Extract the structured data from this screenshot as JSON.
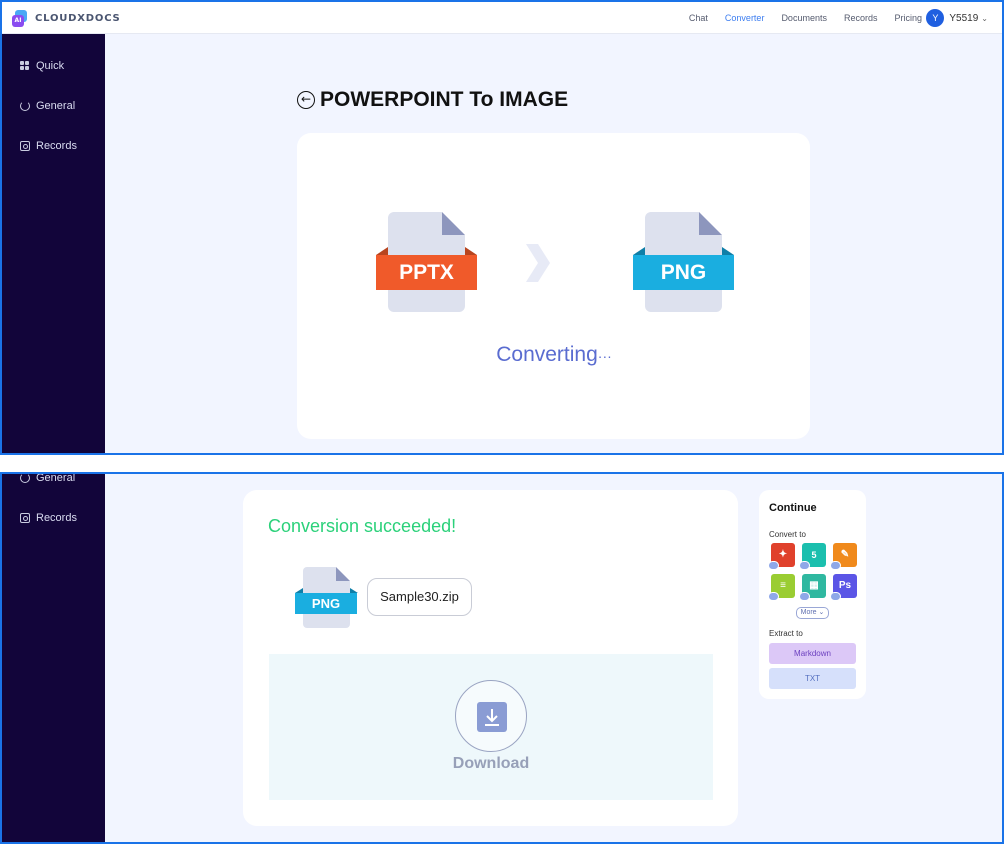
{
  "header": {
    "logo_text": "CLOUDXDOCS",
    "logo_badge": "AI",
    "nav": [
      "Chat",
      "Converter",
      "Documents",
      "Records",
      "Pricing"
    ],
    "active_nav": "Converter",
    "user_initial": "Y",
    "user_name": "Y5519"
  },
  "sidebar": {
    "items": [
      {
        "label": "Quick",
        "icon": "grid-icon"
      },
      {
        "label": "General",
        "icon": "refresh-icon"
      },
      {
        "label": "Records",
        "icon": "record-icon"
      }
    ]
  },
  "converting": {
    "title": "POWERPOINT To IMAGE",
    "source_format": "PPTX",
    "target_format": "PNG",
    "status": "Converting",
    "status_ellipsis": "···"
  },
  "result": {
    "message": "Conversion succeeded!",
    "file_format": "PNG",
    "file_name": "Sample30.zip",
    "download_label": "Download"
  },
  "continue_panel": {
    "title": "Continue",
    "convert_to_label": "Convert to",
    "tiles": [
      {
        "icon": "pdf-icon",
        "color": "#e0412c"
      },
      {
        "icon": "html-icon",
        "color": "#1bbfae"
      },
      {
        "icon": "edit-icon",
        "color": "#f08a1c"
      },
      {
        "icon": "text-doc-icon",
        "color": "#9acd32"
      },
      {
        "icon": "image-grid-icon",
        "color": "#2fb8a0"
      },
      {
        "icon": "photoshop-icon",
        "color": "#5b55e6",
        "text": "Ps"
      }
    ],
    "more_label": "More",
    "extract_to_label": "Extract to",
    "extract_options": [
      "Markdown",
      "TXT"
    ]
  },
  "colors": {
    "accent": "#3d7ef0",
    "sidebar_bg": "#12053a",
    "pptx_band": "#f05a2a",
    "png_band": "#1aaee0",
    "success": "#2bd17a",
    "frame_border": "#1a73e8"
  }
}
